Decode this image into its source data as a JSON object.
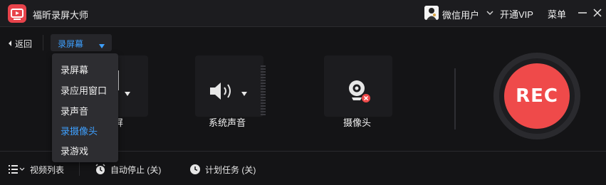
{
  "app": {
    "title": "福昕录屏大师"
  },
  "header": {
    "user_name": "微信用户",
    "vip_label": "开通VIP",
    "menu_label": "菜单"
  },
  "toolbar": {
    "back_label": "返回",
    "mode_selected": "录屏幕"
  },
  "mode_menu": {
    "items": [
      {
        "label": "录屏幕",
        "active": false
      },
      {
        "label": "录应用窗口",
        "active": false
      },
      {
        "label": "录声音",
        "active": false
      },
      {
        "label": "录摄像头",
        "active": true
      },
      {
        "label": "录游戏",
        "active": false
      }
    ]
  },
  "sources": {
    "screen_label_partial": "屏",
    "system_audio_label": "系统声音",
    "camera_label": "摄像头"
  },
  "record": {
    "label": "REC"
  },
  "bottom": {
    "video_list_label": "视频列表",
    "auto_stop_label": "自动停止 (关)",
    "schedule_label": "计划任务 (关)"
  },
  "colors": {
    "accent": "#3ea0ff",
    "rec": "#ef4a4a",
    "background": "#141416"
  }
}
